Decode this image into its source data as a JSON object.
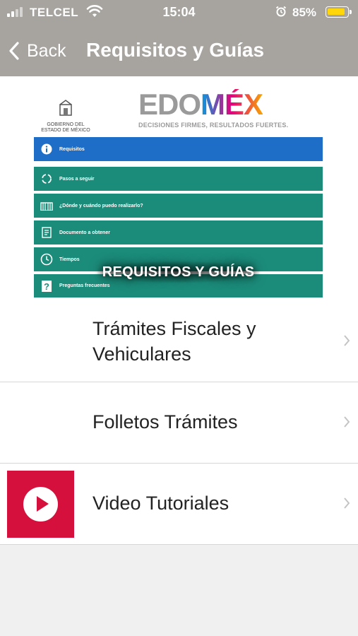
{
  "status_bar": {
    "carrier": "TELCEL",
    "time": "15:04",
    "battery_percent": "85%",
    "battery_color": "#ffd60a",
    "icons": [
      "signal-icon",
      "wifi-icon",
      "alarm-icon",
      "battery-icon"
    ]
  },
  "nav": {
    "back_label": "Back",
    "title": "Requisitos y Guías",
    "bar_color": "#a7a39f"
  },
  "banner": {
    "gob_line1": "GOBIERNO DEL",
    "gob_line2": "ESTADO DE MÉXICO",
    "logo_edo": "EDO",
    "logo_mex": "MÉX",
    "logo_tagline": "DECISIONES FIRMES, RESULTADOS FUERTES.",
    "overlay_title": "REQUISITOS Y GUÍAS",
    "menu": [
      {
        "label": "Requisitos",
        "icon": "info-icon",
        "color": "#1e6ec8"
      },
      {
        "label": "Pasos a seguir",
        "icon": "cycle-icon",
        "color": "#1c8c7a"
      },
      {
        "label": "¿Dónde y cuándo puedo realizarlo?",
        "icon": "building-icon",
        "color": "#1c8c7a"
      },
      {
        "label": "Documento a obtener",
        "icon": "document-icon",
        "color": "#1c8c7a"
      },
      {
        "label": "Tiempos",
        "icon": "clock-icon",
        "color": "#1c8c7a"
      },
      {
        "label": "Preguntas frecuentes",
        "icon": "question-icon",
        "color": "#1c8c7a"
      }
    ]
  },
  "list": {
    "items": [
      {
        "label_line1": "Trámites Fiscales y",
        "label_line2": "Vehiculares"
      },
      {
        "label": "Folletos Trámites"
      },
      {
        "label": "Video Tutoriales",
        "thumb_color": "#d6103c"
      }
    ]
  }
}
